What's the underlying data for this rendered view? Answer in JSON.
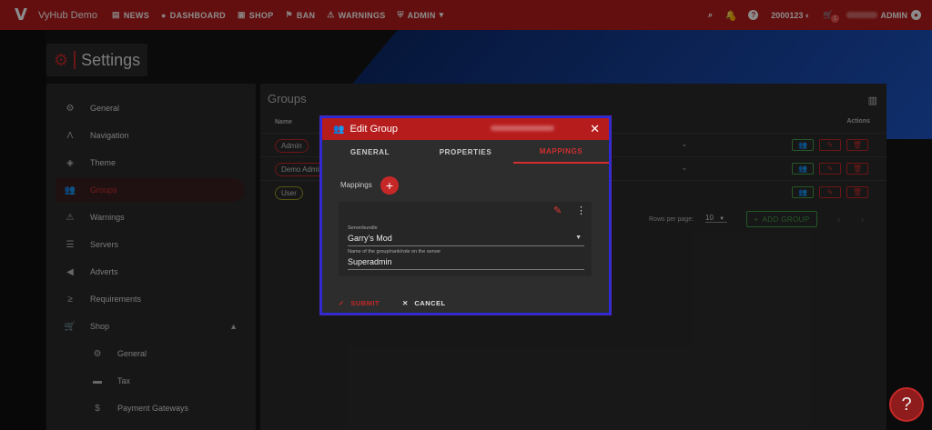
{
  "topbar": {
    "brand": "VyHub Demo",
    "nav": [
      {
        "label": "NEWS",
        "icon": "news-icon",
        "glyph": "▤"
      },
      {
        "label": "DASHBOARD",
        "icon": "person-icon",
        "glyph": "●"
      },
      {
        "label": "SHOP",
        "icon": "bag-icon",
        "glyph": "▣"
      },
      {
        "label": "BAN",
        "icon": "ban-user-icon",
        "glyph": "⚑"
      },
      {
        "label": "WARNINGS",
        "icon": "warning-user-icon",
        "glyph": "⚠"
      },
      {
        "label": "ADMIN",
        "icon": "shield-icon",
        "glyph": "⛨"
      }
    ],
    "credits": "2000123",
    "cart_count": "1",
    "user_label": "ADMIN"
  },
  "page_title": "Settings",
  "sidebar": {
    "items": [
      {
        "label": "General",
        "icon": "gear-icon",
        "glyph": "⚙"
      },
      {
        "label": "Navigation",
        "icon": "navigation-icon",
        "glyph": "Λ"
      },
      {
        "label": "Theme",
        "icon": "paint-bucket-icon",
        "glyph": "◈"
      },
      {
        "label": "Groups",
        "icon": "groups-icon",
        "glyph": "👥"
      },
      {
        "label": "Warnings",
        "icon": "warning-user-icon",
        "glyph": "⚠"
      },
      {
        "label": "Servers",
        "icon": "servers-icon",
        "glyph": "☰"
      },
      {
        "label": "Adverts",
        "icon": "megaphone-icon",
        "glyph": "◀"
      },
      {
        "label": "Requirements",
        "icon": "greater-equal-icon",
        "glyph": "≥"
      },
      {
        "label": "Shop",
        "icon": "cart-icon",
        "glyph": "🛒"
      },
      {
        "label": "General",
        "icon": "gear-icon",
        "glyph": "⚙"
      },
      {
        "label": "Tax",
        "icon": "tax-icon",
        "glyph": "▬"
      },
      {
        "label": "Payment Gateways",
        "icon": "dollar-icon",
        "glyph": "$"
      }
    ]
  },
  "groups": {
    "title": "Groups",
    "col_name": "Name",
    "col_actions": "Actions",
    "rows": [
      {
        "name": "Admin",
        "color": "#c62828"
      },
      {
        "name": "Demo Admin",
        "color": "#c62828"
      },
      {
        "name": "User",
        "color": "#9e9d24"
      }
    ],
    "rows_per_page_label": "Rows per page:",
    "rows_per_page": "10",
    "add_group": "ADD GROUP"
  },
  "dialog": {
    "title": "Edit Group",
    "tabs": [
      "GENERAL",
      "PROPERTIES",
      "MAPPINGS"
    ],
    "active_tab": "MAPPINGS",
    "mappings_label": "Mappings",
    "serverbundle_label": "Serverbundle",
    "serverbundle_value": "Garry's Mod",
    "name_label": "Name of the group/rank/role on the server",
    "name_value": "Superadmin",
    "submit": "SUBMIT",
    "cancel": "CANCEL"
  },
  "help_glyph": "?",
  "colors": {
    "primary": "#b71c1c",
    "success": "#43a047",
    "highlight": "#2a2ad8"
  }
}
